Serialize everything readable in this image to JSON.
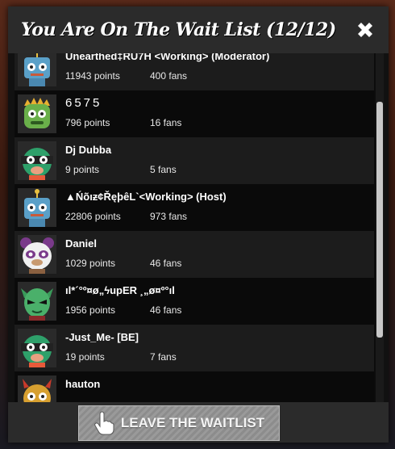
{
  "header": {
    "title": "You Are On The Wait List (12/12)"
  },
  "footer": {
    "leave_label": "LEAVE THE WAITLIST"
  },
  "users": [
    {
      "name": "Unearthed‡RU7H <Working> (Moderator)",
      "points": "11943 points",
      "fans": "400 fans",
      "avatar": "robot-avatar-icon"
    },
    {
      "name": "6575",
      "points": "796 points",
      "fans": "16 fans",
      "avatar": "green-monster-avatar-icon"
    },
    {
      "name": "Dj Dubba",
      "points": "9 points",
      "fans": "5 fans",
      "avatar": "green-headphones-avatar-icon"
    },
    {
      "name": "▲Ńõıƶ¢ŘęþêL`<Working> (Host)",
      "points": "22806 points",
      "fans": "973 fans",
      "avatar": "robot-avatar-icon"
    },
    {
      "name": "Daniel",
      "points": "1029 points",
      "fans": "46 fans",
      "avatar": "panda-avatar-icon"
    },
    {
      "name": "ıl*´°º¤ø„ϟupER ¸„ø¤º°ıl",
      "points": "1956 points",
      "fans": "46 fans",
      "avatar": "green-alien-avatar-icon"
    },
    {
      "name": "-Just_Me- [BE]",
      "points": "19 points",
      "fans": "7 fans",
      "avatar": "green-headphones-avatar-icon"
    },
    {
      "name": "hauton",
      "points": "",
      "fans": "",
      "avatar": "horned-avatar-icon"
    }
  ],
  "colors": {
    "header_bg": "#2b2b2b",
    "row_alt": "#1c1c1c",
    "row_base": "#0a0a0a",
    "button_bg": "#9a9a9a"
  }
}
